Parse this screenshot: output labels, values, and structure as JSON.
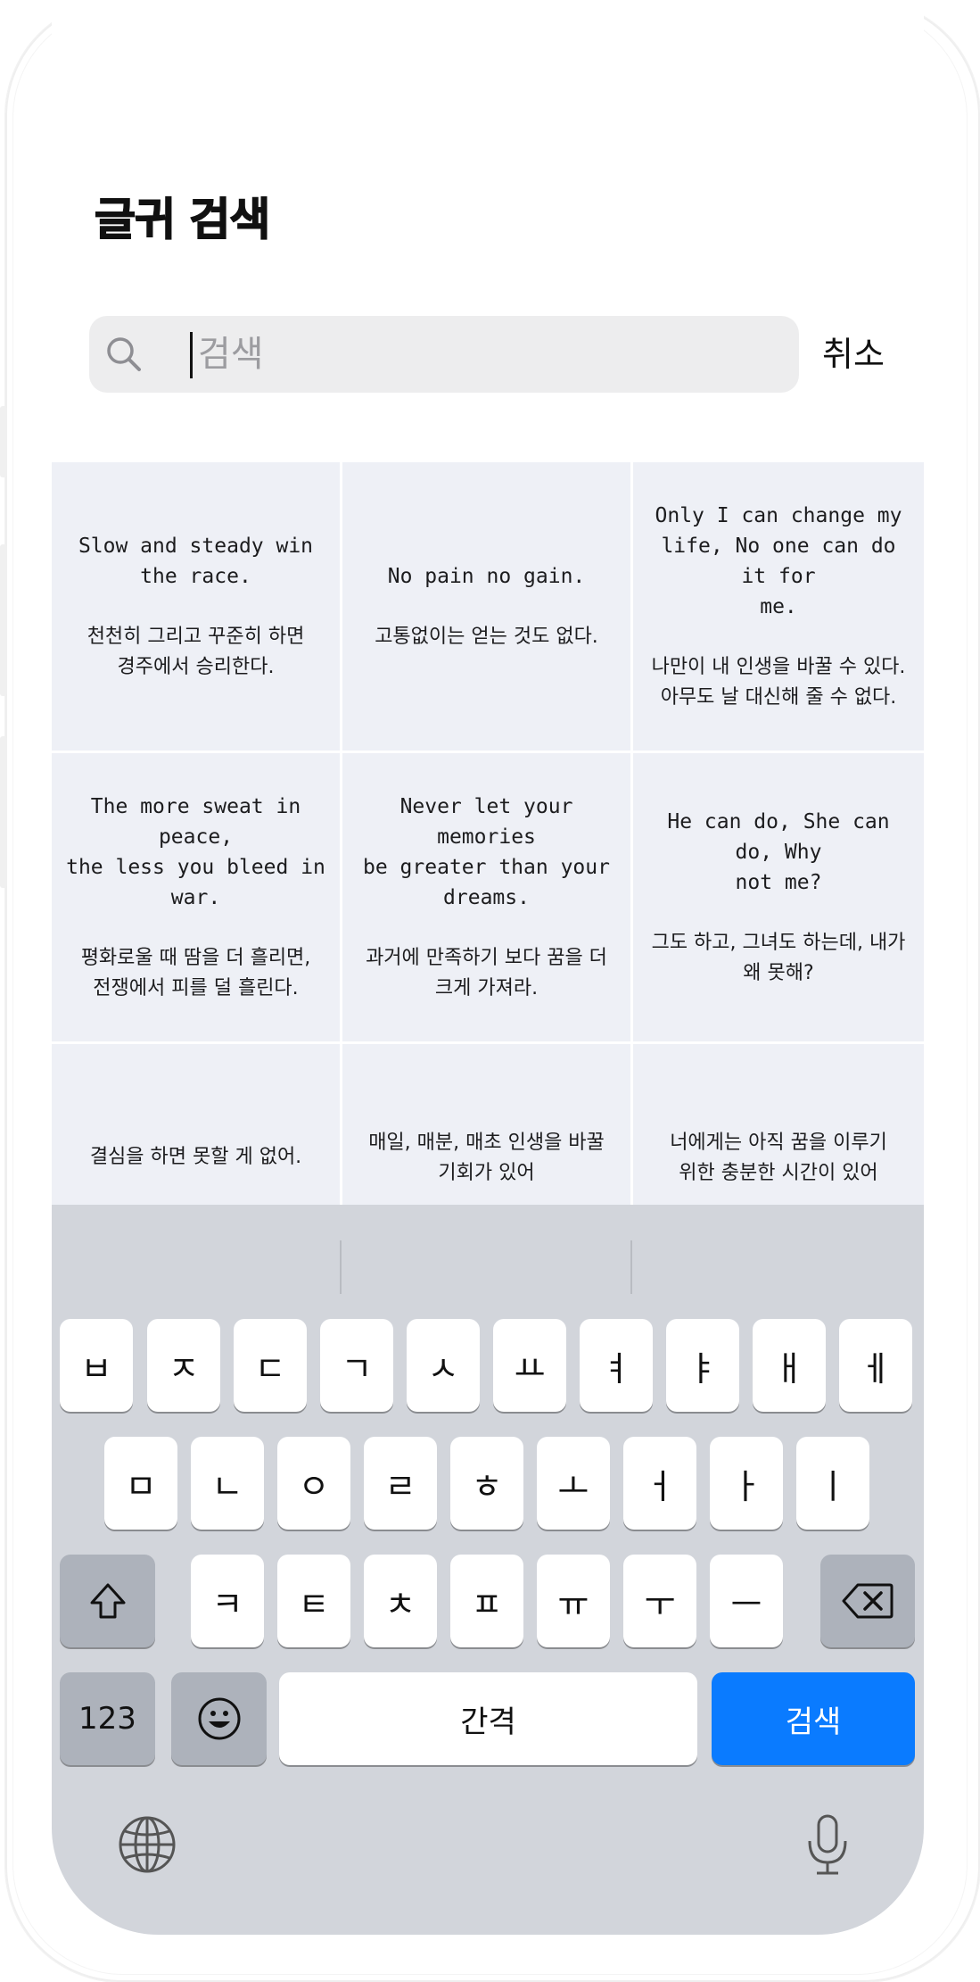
{
  "header": {
    "title": "글귀 검색"
  },
  "search": {
    "placeholder": "검색",
    "value": "",
    "cancel_label": "취소"
  },
  "quotes": [
    {
      "en": "Slow and steady win\nthe race.",
      "ko": "천천히 그리고 꾸준히 하면\n경주에서 승리한다."
    },
    {
      "en": "No pain no gain.",
      "ko": "고통없이는 얻는 것도 없다."
    },
    {
      "en": "Only I can change my\nlife, No one can do it for\nme.",
      "ko": "나만이 내 인생을 바꿀 수 있다.\n아무도 날 대신해 줄 수 없다."
    },
    {
      "en": "The more sweat in peace,\nthe less you bleed in war.",
      "ko": "평화로울 때 땀을 더 흘리면,\n전쟁에서 피를 덜 흘린다."
    },
    {
      "en": "Never let your memories\nbe greater than your\ndreams.",
      "ko": "과거에 만족하기 보다 꿈을 더\n크게 가져라."
    },
    {
      "en": "He can do, She can do, Why\nnot me?",
      "ko": "그도 하고, 그녀도 하는데, 내가\n왜 못해?"
    },
    {
      "en": "",
      "ko": "결심을 하면 못할 게 없어."
    },
    {
      "en": "",
      "ko": "매일, 매분, 매초 인생을 바꿀\n기회가 있어"
    },
    {
      "en": "",
      "ko": "너에게는 아직 꿈을 이루기\n위한 충분한 시간이 있어"
    }
  ],
  "keyboard": {
    "row1": [
      "ㅂ",
      "ㅈ",
      "ㄷ",
      "ㄱ",
      "ㅅ",
      "ㅛ",
      "ㅕ",
      "ㅑ",
      "ㅐ",
      "ㅔ"
    ],
    "row2": [
      "ㅁ",
      "ㄴ",
      "ㅇ",
      "ㄹ",
      "ㅎ",
      "ㅗ",
      "ㅓ",
      "ㅏ",
      "ㅣ"
    ],
    "row3": [
      "ㅋ",
      "ㅌ",
      "ㅊ",
      "ㅍ",
      "ㅠ",
      "ㅜ",
      "ㅡ"
    ],
    "shift_icon": "shift-icon",
    "delete_icon": "delete-icon",
    "numbers_label": "123",
    "emoji_icon": "emoji-icon",
    "space_label": "간격",
    "search_label": "검색",
    "globe_icon": "globe-icon",
    "mic_icon": "microphone-icon",
    "accent_color": "#0a7bff"
  }
}
